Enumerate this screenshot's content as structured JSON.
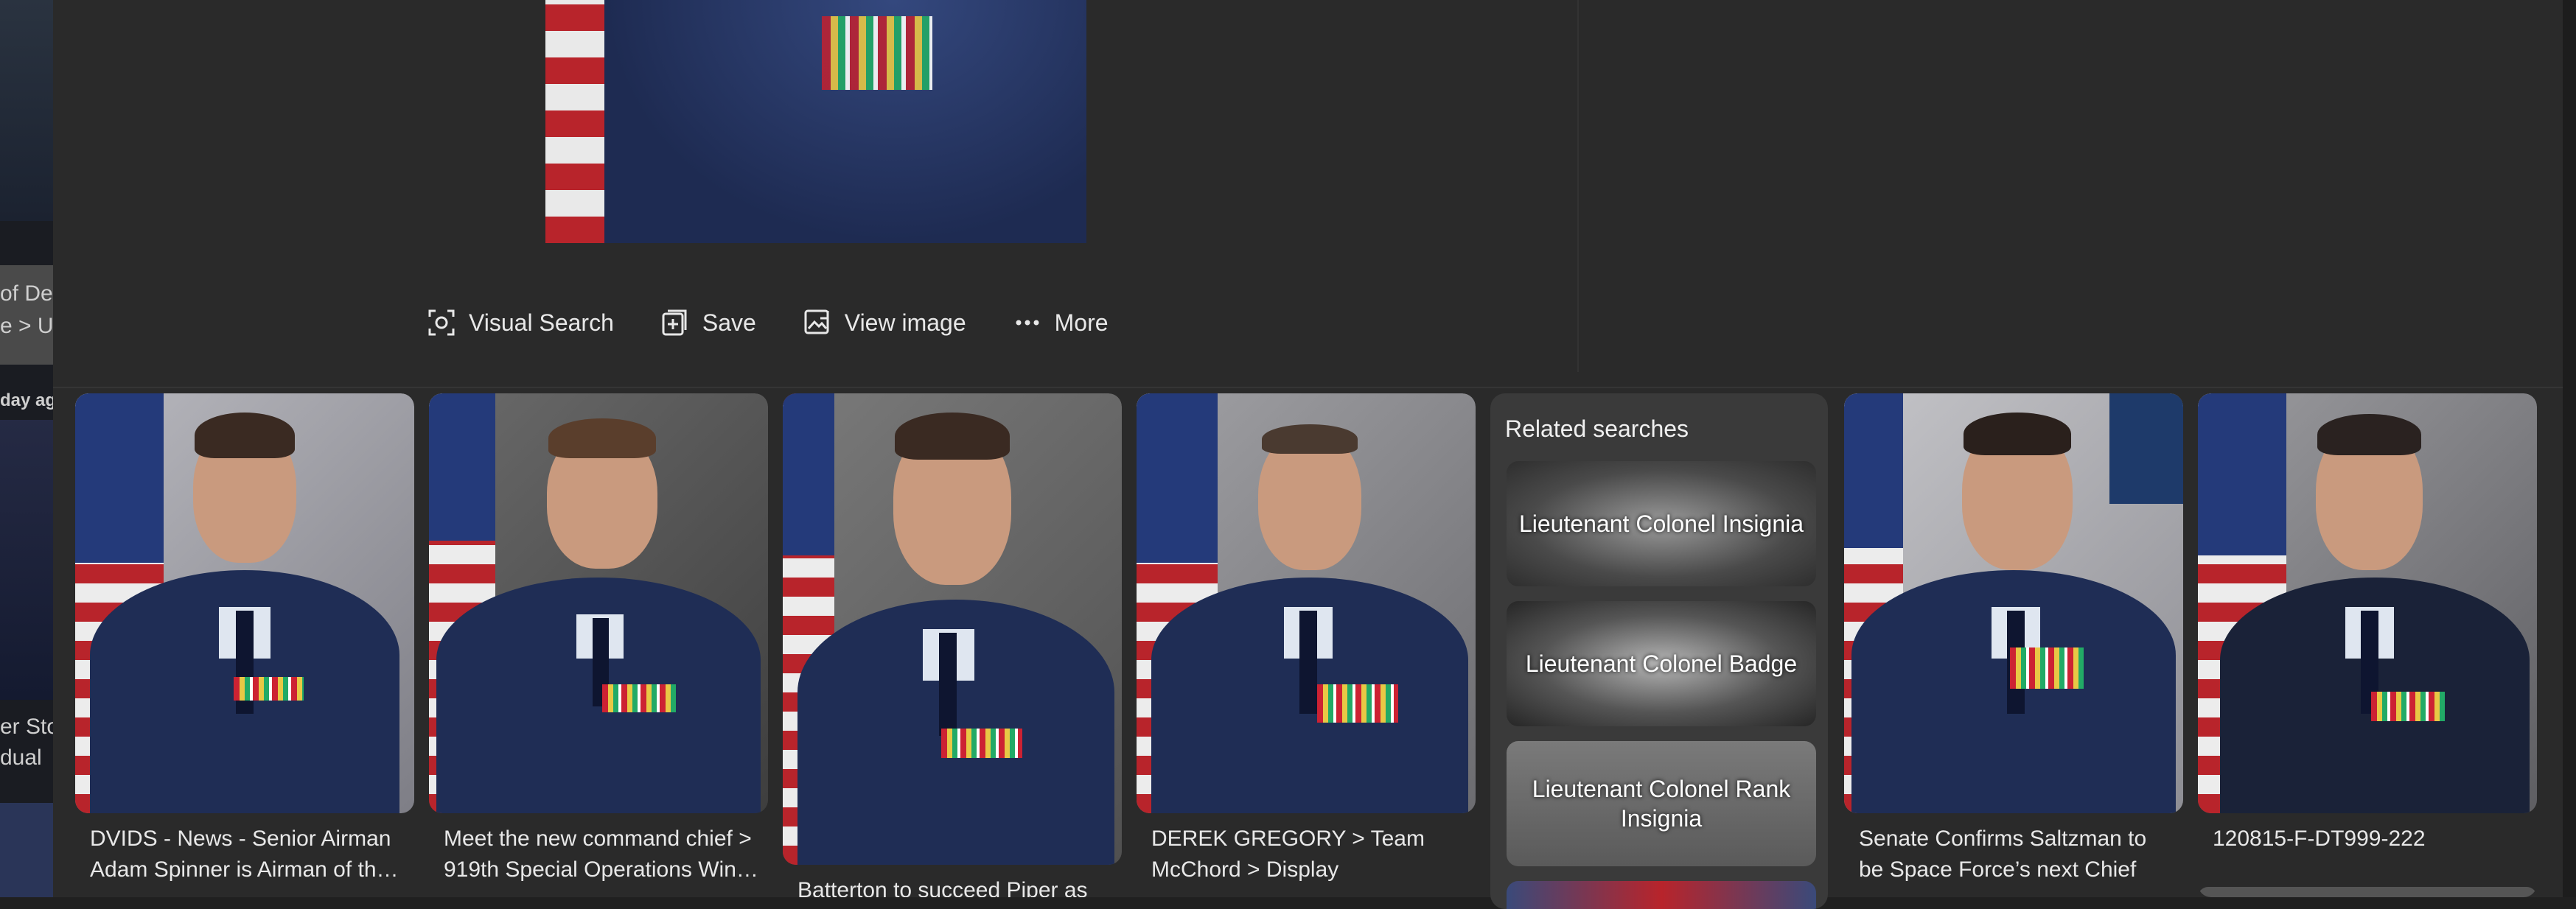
{
  "left_strip": {
    "text_1": "of De",
    "text_2": "e > U.",
    "text_3": "day ag",
    "text_4": "er Sto",
    "text_5": "dual"
  },
  "actions": [
    {
      "label": "Visual Search",
      "icon": "visual-search-icon"
    },
    {
      "label": "Save",
      "icon": "save-add-icon"
    },
    {
      "label": "View image",
      "icon": "view-image-icon"
    },
    {
      "label": "More",
      "icon": "more-dots-icon"
    }
  ],
  "results": [
    {
      "caption": "DVIDS - News - Senior Airman Adam Spinner is Airman of th…"
    },
    {
      "caption": "Meet the new command chief > 919th Special Operations Win…"
    },
    {
      "caption": "Batterton to succeed Piper as"
    },
    {
      "caption": "DEREK GREGORY > Team McChord > Display"
    },
    {
      "caption": "Senate Confirms Saltzman to be Space Force’s next Chief o…"
    },
    {
      "caption": "120815-F-DT999-222"
    }
  ],
  "related": {
    "title": "Related searches",
    "items": [
      {
        "label": "Lieutenant Colonel Insignia"
      },
      {
        "label": "Lieutenant Colonel Badge"
      },
      {
        "label": "Lieutenant Colonel Rank Insignia"
      }
    ]
  },
  "colors": {
    "background": "#202020",
    "panel": "#2a2a2a",
    "related_bg": "#3a3a3a",
    "text": "#e8e8e8"
  }
}
